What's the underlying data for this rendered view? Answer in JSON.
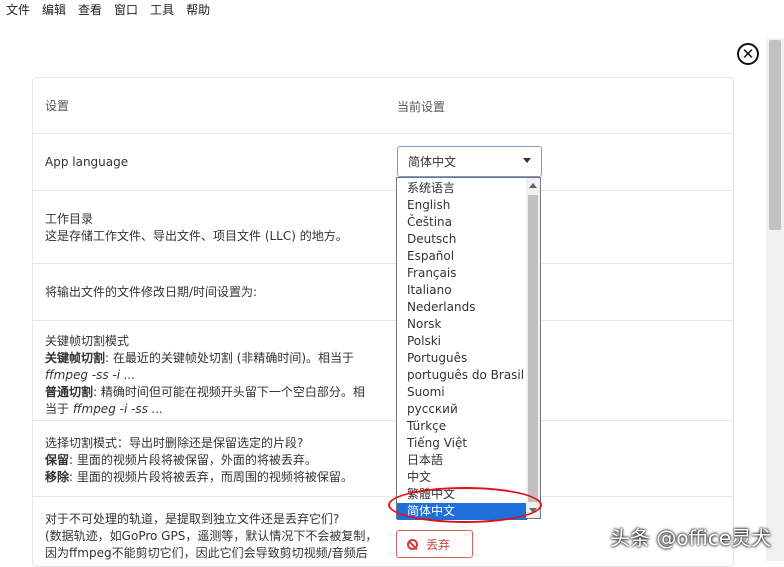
{
  "menubar": {
    "items": [
      "文件",
      "编辑",
      "查看",
      "窗口",
      "工具",
      "帮助"
    ]
  },
  "table": {
    "header": {
      "label": "设置",
      "value": "当前设置"
    },
    "app_language": {
      "label": "App language",
      "selected": "简体中文"
    },
    "workdir": {
      "title": "工作目录",
      "desc": "这是存储工作文件、导出文件、项目文件 (LLC) 的地方。"
    },
    "file_date": {
      "label": "将输出文件的文件修改日期/时间设置为:"
    },
    "keyframe": {
      "title": "关键帧切割模式",
      "kf_bold": "关键帧切割",
      "kf_text": ": 在最近的关键帧处切割 (非精确时间)。相当于",
      "kf_cmd": "ffmpeg -ss -i ...",
      "normal_bold": "普通切割",
      "normal_text": ": 精确时间但可能在视频开头留下一个空白部分。相",
      "normal_text2": "当于",
      "normal_cmd": "ffmpeg -i -ss ..."
    },
    "cut_mode": {
      "title": "选择切割模式：导出时删除还是保留选定的片段?",
      "keep_bold": "保留",
      "keep_text": ": 里面的视频片段将被保留，外面的将被丢弃。",
      "remove_bold": "移除",
      "remove_text": ": 里面的视频片段将被丢弃，而周围的视频将被保留。"
    },
    "tracks": {
      "line1": "对于不可处理的轨道，是提取到独立文件还是丢弃它们?",
      "line2": "(数据轨迹，如GoPro GPS，遥测等，默认情况下不会被复制，",
      "line3": "因为ffmpeg不能剪切它们，因此它们会导致剪切视频/音频后"
    },
    "discard_label": "丢弃"
  },
  "dropdown": {
    "options": [
      "系统语言",
      "English",
      "Čeština",
      "Deutsch",
      "Español",
      "Français",
      "Italiano",
      "Nederlands",
      "Norsk",
      "Polski",
      "Português",
      "português do Brasil",
      "Suomi",
      "русский",
      "Türkçe",
      "Tiếng Việt",
      "日本語",
      "中文",
      "繁體中文",
      "简体中文"
    ],
    "selected_index": 19
  },
  "watermark": "头条 @office灵犬",
  "colors": {
    "accent": "#1e6fd9",
    "annotation": "#e0101a",
    "danger": "#d23c3c"
  }
}
